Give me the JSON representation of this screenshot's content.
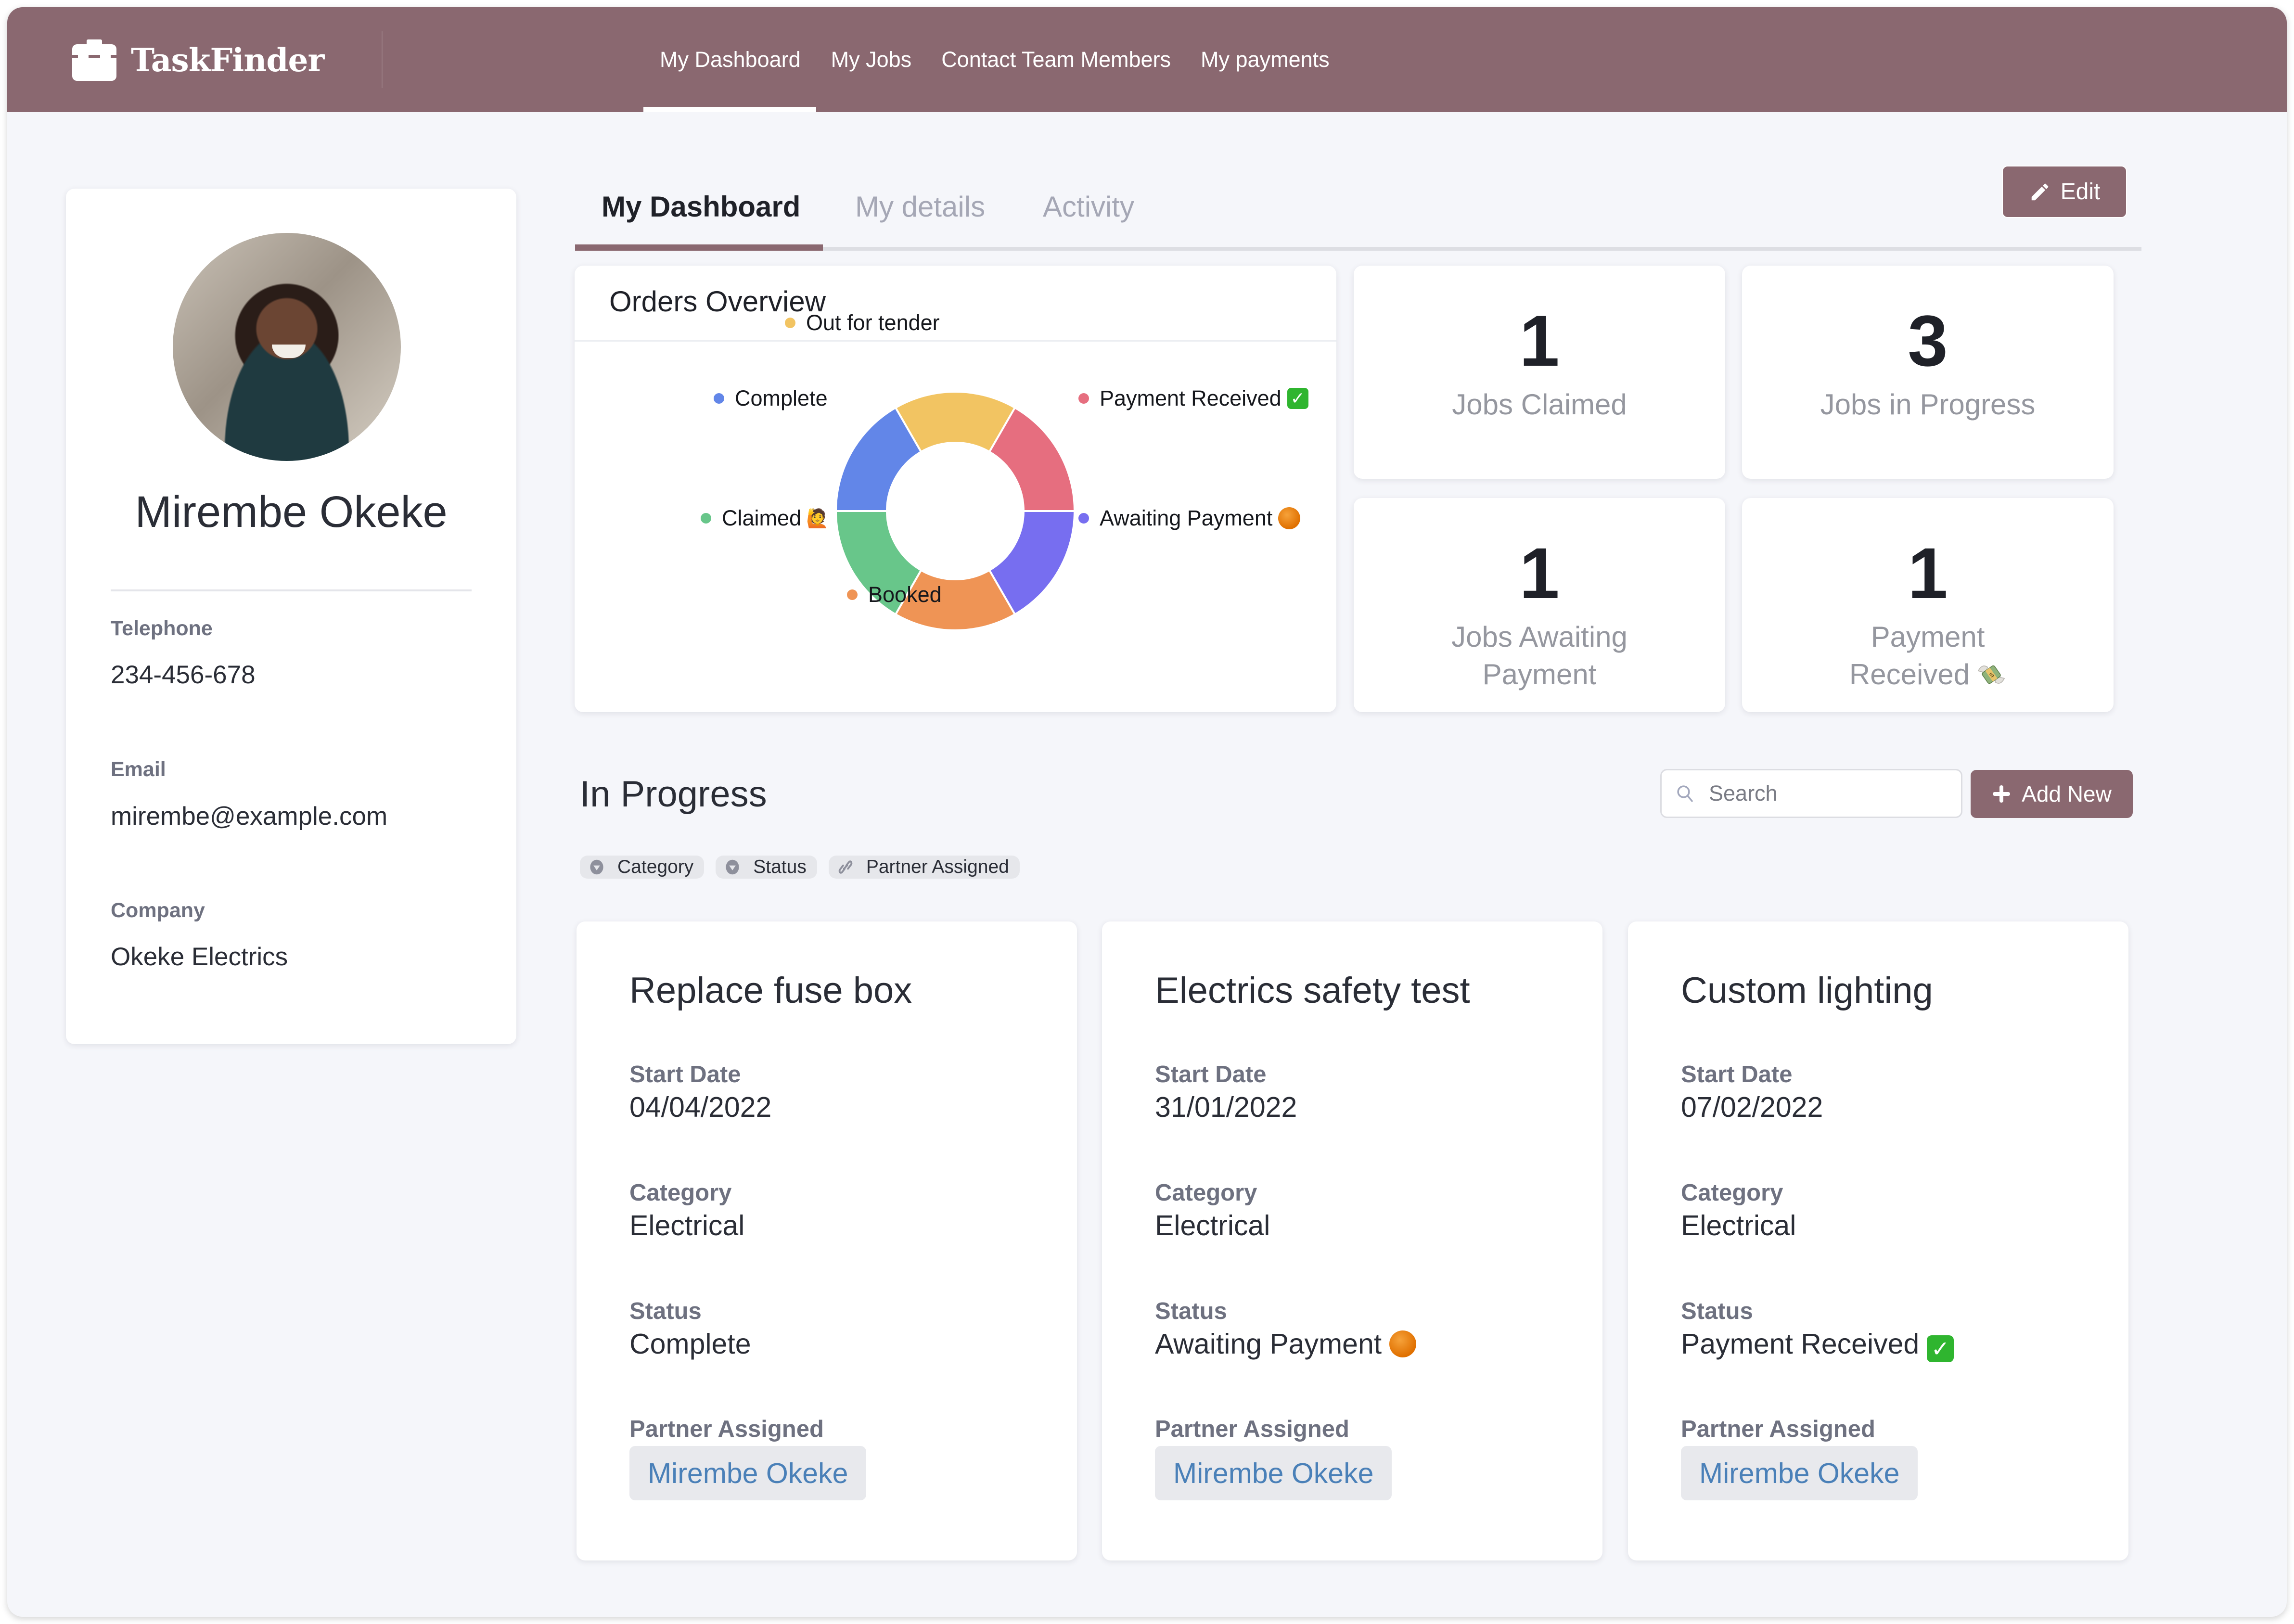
{
  "app": {
    "brand": "TaskFinder",
    "brand_icon": "briefcase-icon",
    "accent_color": "#8a6870"
  },
  "nav": {
    "items": [
      {
        "label": "My Dashboard",
        "active": true
      },
      {
        "label": "My Jobs",
        "active": false
      },
      {
        "label": "Contact Team Members",
        "active": false
      },
      {
        "label": "My payments",
        "active": false
      }
    ]
  },
  "profile": {
    "name": "Mirembe Okeke",
    "fields": [
      {
        "label": "Telephone",
        "value": "234-456-678"
      },
      {
        "label": "Email",
        "value": "mirembe@example.com"
      },
      {
        "label": "Company",
        "value": "Okeke Electrics"
      }
    ]
  },
  "tabs": {
    "items": [
      {
        "label": "My Dashboard",
        "active": true
      },
      {
        "label": "My details",
        "active": false
      },
      {
        "label": "Activity",
        "active": false
      }
    ],
    "edit_label": "Edit",
    "edit_icon": "pencil-icon"
  },
  "orders_overview": {
    "title": "Orders Overview"
  },
  "chart_data": {
    "type": "pie",
    "variant": "donut",
    "title": "Orders Overview",
    "categories": [
      "Out for tender",
      "Payment Received",
      "Awaiting Payment",
      "Booked",
      "Claimed",
      "Complete"
    ],
    "values": [
      1,
      1,
      1,
      1,
      1,
      1
    ],
    "colors": [
      "#f2c462",
      "#e66e7f",
      "#776ef0",
      "#ef9455",
      "#68c68a",
      "#6286e8"
    ],
    "legend_suffix": [
      "",
      "✅",
      "🟠",
      "",
      "🙋",
      ""
    ],
    "legend": "around-chart",
    "start_angle_deg": -30
  },
  "stats": [
    {
      "value": "1",
      "label": "Jobs Claimed"
    },
    {
      "value": "3",
      "label": "Jobs in Progress"
    },
    {
      "value": "1",
      "label": "Jobs Awaiting Payment"
    },
    {
      "value": "1",
      "label": "Payment Received",
      "emoji": "💸"
    }
  ],
  "in_progress": {
    "title": "In Progress",
    "search_placeholder": "Search",
    "search_value": "",
    "add_label": "Add New",
    "filters": [
      {
        "label": "Category",
        "icon": "dropdown-circle-icon"
      },
      {
        "label": "Status",
        "icon": "dropdown-circle-icon"
      },
      {
        "label": "Partner Assigned",
        "icon": "link-icon"
      }
    ],
    "field_labels": {
      "start_date": "Start Date",
      "category": "Category",
      "status": "Status",
      "partner": "Partner Assigned"
    },
    "jobs": [
      {
        "title": "Replace fuse box",
        "start_date": "04/04/2022",
        "category": "Electrical",
        "status": "Complete",
        "status_emoji": "",
        "partner": "Mirembe Okeke"
      },
      {
        "title": "Electrics safety test",
        "start_date": "31/01/2022",
        "category": "Electrical",
        "status": "Awaiting Payment",
        "status_emoji": "🟠",
        "partner": "Mirembe Okeke"
      },
      {
        "title": "Custom lighting",
        "start_date": "07/02/2022",
        "category": "Electrical",
        "status": "Payment Received",
        "status_emoji": "✅",
        "partner": "Mirembe Okeke"
      }
    ]
  }
}
